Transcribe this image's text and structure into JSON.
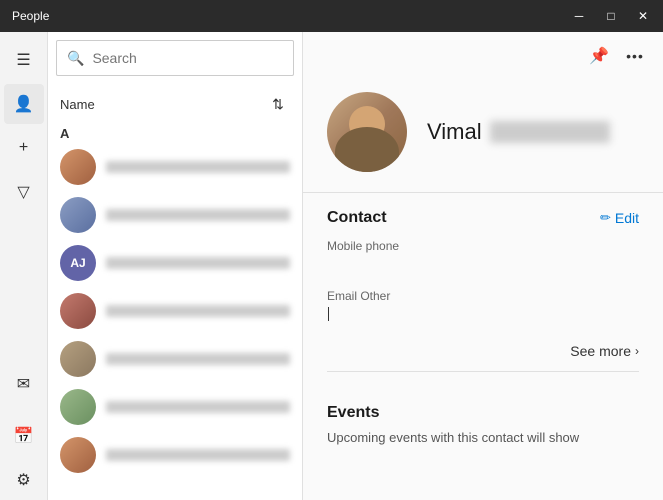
{
  "titleBar": {
    "title": "People",
    "minimizeLabel": "─",
    "maximizeLabel": "□",
    "closeLabel": "✕"
  },
  "iconRail": {
    "hamburgerIcon": "☰",
    "contactIcon": "👤",
    "addIcon": "+",
    "filterIcon": "▽",
    "mailIcon": "✉",
    "calendarIcon": "📅",
    "settingsIcon": "⚙"
  },
  "contactList": {
    "searchPlaceholder": "Search",
    "columnName": "Name",
    "sectionLetter": "A",
    "contacts": [
      {
        "id": 1,
        "avatarType": "photo",
        "avatarClass": "avatar-sim-1"
      },
      {
        "id": 2,
        "avatarType": "photo",
        "avatarClass": "avatar-sim-2"
      },
      {
        "id": 3,
        "avatarType": "initials",
        "initials": "AJ",
        "avatarClass": ""
      },
      {
        "id": 4,
        "avatarType": "photo",
        "avatarClass": "avatar-sim-3"
      },
      {
        "id": 5,
        "avatarType": "photo",
        "avatarClass": "avatar-sim-4"
      },
      {
        "id": 6,
        "avatarType": "photo",
        "avatarClass": "avatar-sim-5"
      },
      {
        "id": 7,
        "avatarType": "photo",
        "avatarClass": "avatar-sim-1"
      }
    ]
  },
  "detailPanel": {
    "pinIcon": "📌",
    "moreIcon": "•••",
    "profileName": "Vimal",
    "contact": {
      "sectionTitle": "Contact",
      "editLabel": "Edit",
      "mobilePhoneLabel": "Mobile phone",
      "mobilePhoneValue": "",
      "emailOtherLabel": "Email Other",
      "emailOtherValue": ""
    },
    "seeMoreLabel": "See more",
    "events": {
      "title": "Events",
      "description": "Upcoming events with this contact will show"
    }
  }
}
